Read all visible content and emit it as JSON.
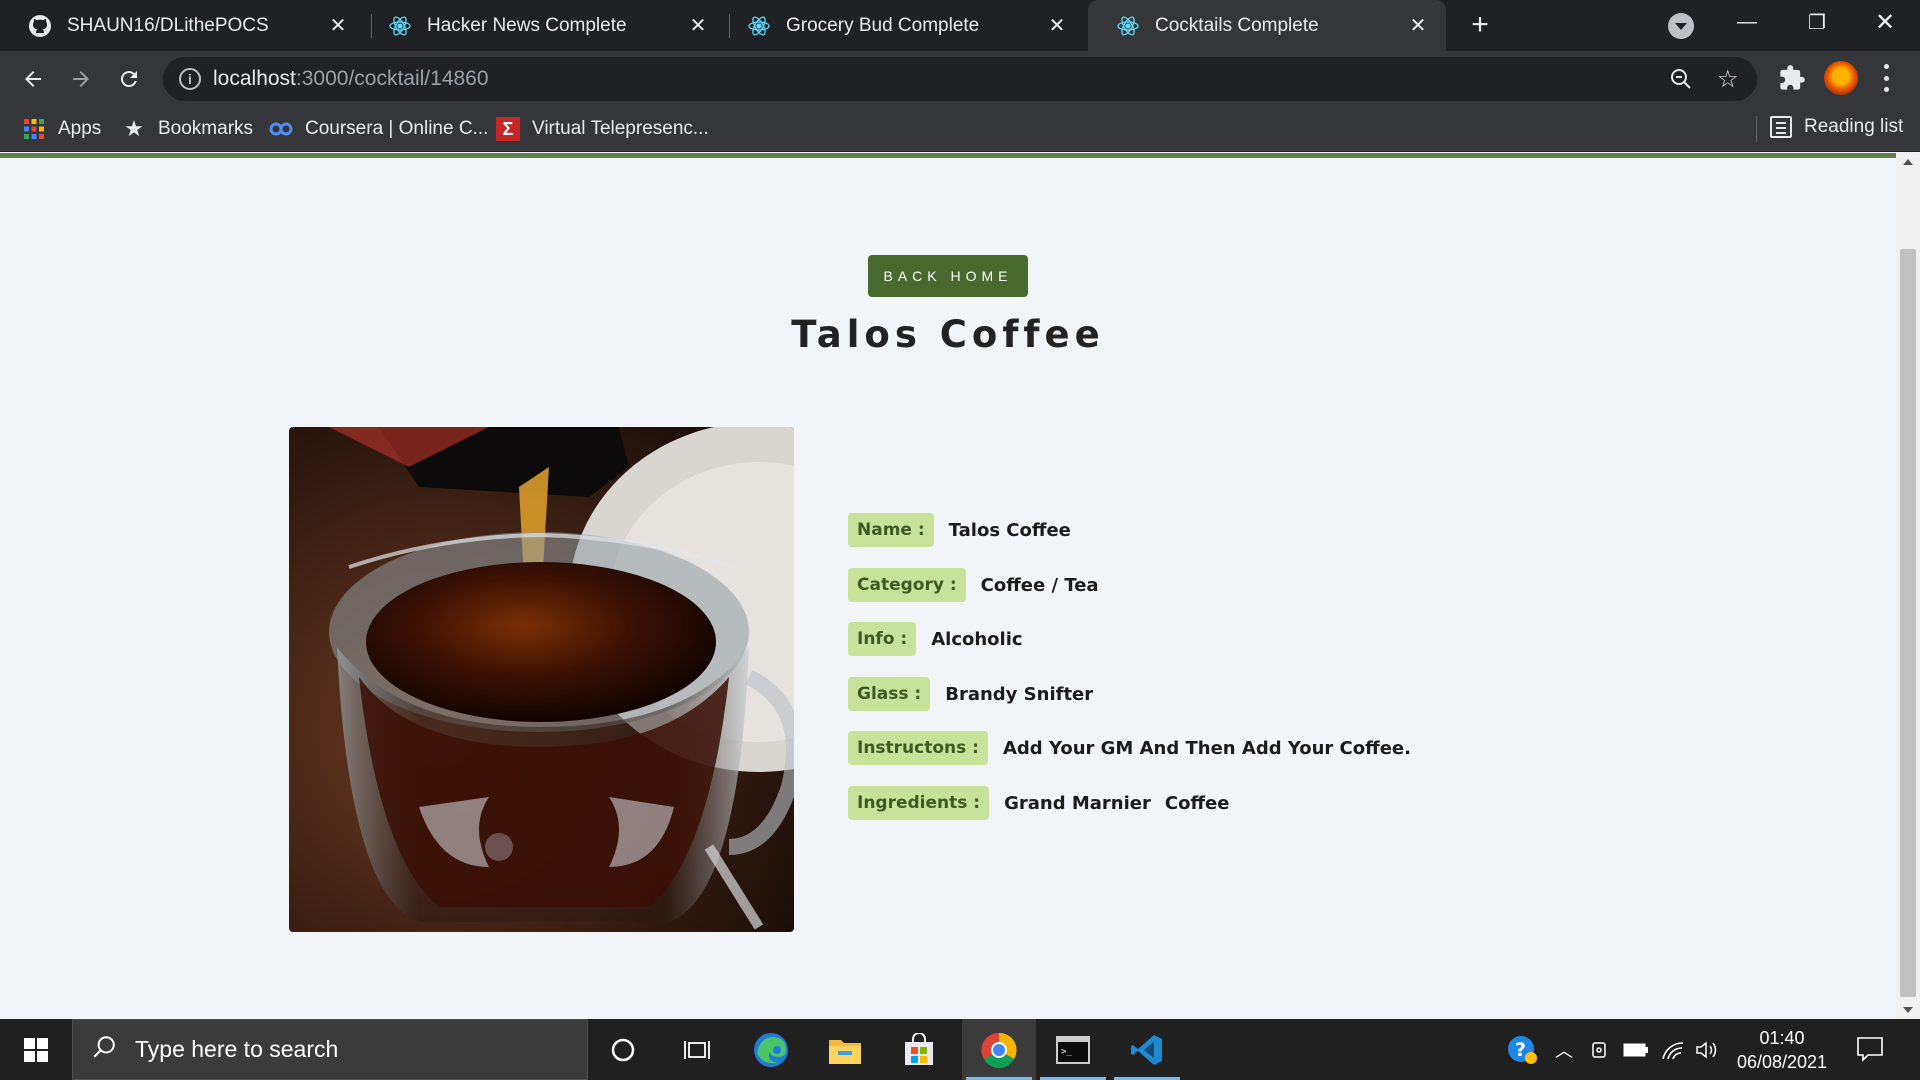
{
  "browser": {
    "tabs": [
      {
        "title": "SHAUN16/DLithePOCS",
        "icon": "github-icon",
        "active": false
      },
      {
        "title": "Hacker News Complete",
        "icon": "react-icon",
        "active": false
      },
      {
        "title": "Grocery Bud Complete",
        "icon": "react-icon",
        "active": false
      },
      {
        "title": "Cocktails Complete",
        "icon": "react-icon",
        "active": true
      }
    ],
    "address": {
      "host": "localhost",
      "path": ":3000/cocktail/14860"
    },
    "bookmarks": [
      {
        "label": "Apps",
        "icon": "apps-grid-icon"
      },
      {
        "label": "Bookmarks",
        "icon": "star-icon"
      },
      {
        "label": "Coursera | Online C...",
        "icon": "coursera-icon"
      },
      {
        "label": "Virtual Telepresenc...",
        "icon": "sigma-icon"
      }
    ],
    "reading_list": "Reading list"
  },
  "page": {
    "back_button": "BACK HOME",
    "title": "Talos Coffee",
    "image_icon": "coffee-photo",
    "details": [
      {
        "label": "Name :",
        "value": "Talos Coffee"
      },
      {
        "label": "Category :",
        "value": "Coffee / Tea"
      },
      {
        "label": "Info :",
        "value": "Alcoholic"
      },
      {
        "label": "Glass :",
        "value": "Brandy Snifter"
      },
      {
        "label": "Instructons :",
        "value": "Add Your GM And Then Add Your Coffee."
      }
    ],
    "ingredients": {
      "label": "Ingredients :",
      "items": [
        "Grand Marnier",
        "Coffee"
      ]
    }
  },
  "taskbar": {
    "search_placeholder": "Type here to search",
    "time": "01:40",
    "date": "06/08/2021"
  },
  "colors": {
    "accent_green": "#476a2e",
    "label_bg": "#c8e29a",
    "page_bg": "#f1f5f8"
  }
}
